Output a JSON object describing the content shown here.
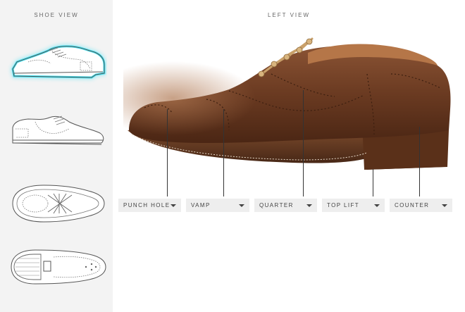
{
  "sidebar": {
    "title": "SHOE VIEW",
    "views": [
      {
        "name": "Left view",
        "icon": "shoe-side-left-icon",
        "selected": true
      },
      {
        "name": "Right view",
        "icon": "shoe-side-right-icon",
        "selected": false
      },
      {
        "name": "Top view",
        "icon": "shoe-top-icon",
        "selected": false
      },
      {
        "name": "Sole view",
        "icon": "shoe-sole-icon",
        "selected": false
      }
    ],
    "highlight_color": "#3fe0f0"
  },
  "main": {
    "title": "LEFT VIEW",
    "photo": "brown leather brogue oxford shoe",
    "parts": [
      {
        "label": "PUNCH HOLE"
      },
      {
        "label": "VAMP"
      },
      {
        "label": "QUARTER"
      },
      {
        "label": "TOP LIFT"
      },
      {
        "label": "COUNTER"
      }
    ]
  }
}
